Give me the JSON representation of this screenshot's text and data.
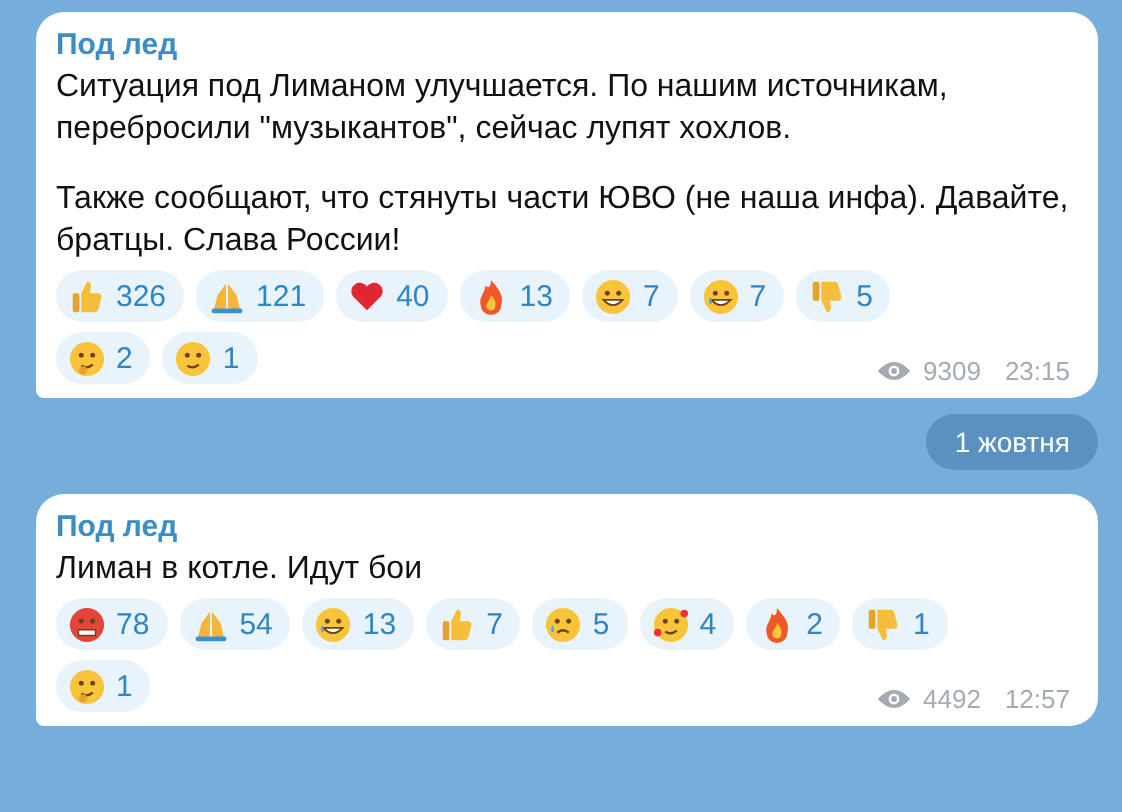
{
  "messages": [
    {
      "author": "Под лед",
      "paragraphs": [
        "Ситуация под Лиманом улучшается. По нашим источникам, перебросили \"музыкантов\", сейчас лупят хохлов.",
        "Также сообщают, что стянуты части ЮВО (не наша инфа). Давайте, братцы. Слава России!"
      ],
      "reactions": [
        {
          "kind": "thumbs-up",
          "count": "326"
        },
        {
          "kind": "pray",
          "count": "121"
        },
        {
          "kind": "heart",
          "count": "40"
        },
        {
          "kind": "fire",
          "count": "13"
        },
        {
          "kind": "grin",
          "count": "7"
        },
        {
          "kind": "laugh",
          "count": "7"
        },
        {
          "kind": "thumbs-down",
          "count": "5"
        },
        {
          "kind": "thinking",
          "count": "2"
        },
        {
          "kind": "woozy",
          "count": "1"
        }
      ],
      "views": "9309",
      "time": "23:15"
    },
    {
      "date_separator": "1 жовтня"
    },
    {
      "author": "Под лед",
      "paragraphs": [
        "Лиман в котле. Идут бои"
      ],
      "reactions": [
        {
          "kind": "angry",
          "count": "78"
        },
        {
          "kind": "pray",
          "count": "54"
        },
        {
          "kind": "laugh",
          "count": "13"
        },
        {
          "kind": "thumbs-up",
          "count": "7"
        },
        {
          "kind": "cry",
          "count": "5"
        },
        {
          "kind": "hearts-face",
          "count": "4"
        },
        {
          "kind": "fire",
          "count": "2"
        },
        {
          "kind": "thumbs-down",
          "count": "1"
        },
        {
          "kind": "thinking",
          "count": "1"
        }
      ],
      "views": "4492",
      "time": "12:57"
    }
  ]
}
